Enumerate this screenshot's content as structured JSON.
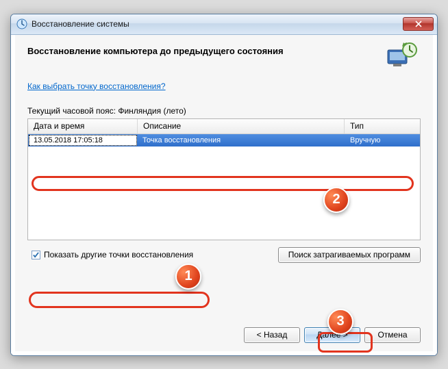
{
  "window": {
    "title": "Восстановление системы"
  },
  "heading": "Восстановление компьютера до предыдущего состояния",
  "link": "Как выбрать точку восстановления?",
  "timezone_label": "Текущий часовой пояс: Финляндия (лето)",
  "table": {
    "headers": {
      "datetime": "Дата и время",
      "desc": "Описание",
      "type": "Тип"
    },
    "rows": [
      {
        "datetime": "13.05.2018 17:05:18",
        "desc": "Точка восстановления",
        "type": "Вручную"
      }
    ]
  },
  "checkbox": {
    "label": "Показать другие точки восстановления",
    "checked": true
  },
  "buttons": {
    "affected": "Поиск затрагиваемых программ",
    "back": "< Назад",
    "next": "Далее >",
    "cancel": "Отмена"
  },
  "annotations": {
    "b1": "1",
    "b2": "2",
    "b3": "3"
  }
}
